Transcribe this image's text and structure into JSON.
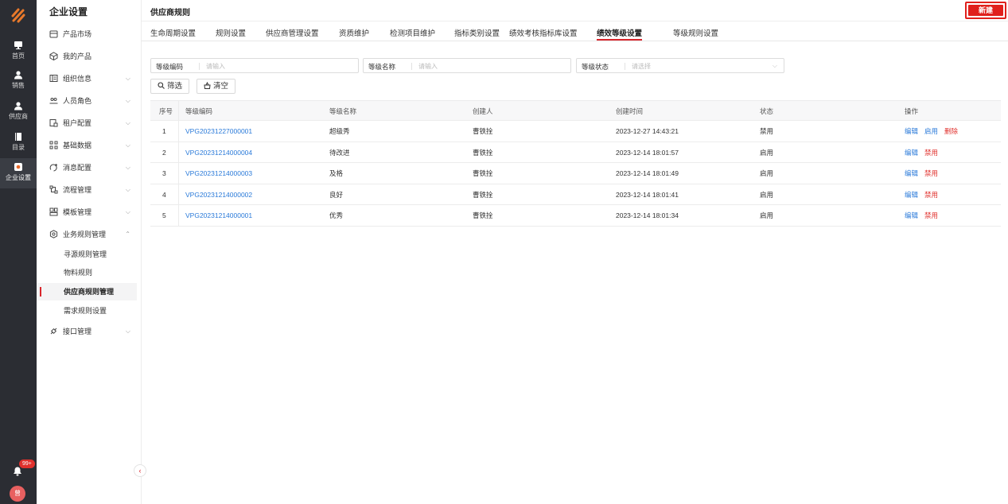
{
  "rail": {
    "items": [
      {
        "label": "首页",
        "icon": "monitor-icon"
      },
      {
        "label": "销售",
        "icon": "user-icon"
      },
      {
        "label": "供应商",
        "icon": "user-icon"
      },
      {
        "label": "目录",
        "icon": "book-icon"
      },
      {
        "label": "企业设置",
        "icon": "gear-icon"
      }
    ],
    "badge": "99+",
    "avatar": "曾"
  },
  "sidebar": {
    "title": "企业设置",
    "items": [
      {
        "label": "产品市场",
        "icon": "store-icon",
        "expandable": false
      },
      {
        "label": "我的产品",
        "icon": "box-icon",
        "expandable": false
      },
      {
        "label": "组织信息",
        "icon": "building-icon",
        "expandable": true
      },
      {
        "label": "人员角色",
        "icon": "people-icon",
        "expandable": true
      },
      {
        "label": "租户配置",
        "icon": "tenant-icon",
        "expandable": true
      },
      {
        "label": "基础数据",
        "icon": "grid-icon",
        "expandable": true
      },
      {
        "label": "消息配置",
        "icon": "message-icon",
        "expandable": true
      },
      {
        "label": "流程管理",
        "icon": "flow-icon",
        "expandable": true
      },
      {
        "label": "模板管理",
        "icon": "template-icon",
        "expandable": true
      },
      {
        "label": "业务规则管理",
        "icon": "settings-icon",
        "expandable": true
      }
    ],
    "sub_items": [
      "寻源规则管理",
      "物料规则",
      "供应商规则管理",
      "需求规则设置"
    ],
    "active_sub": "供应商规则管理",
    "last_item": {
      "label": "接口管理",
      "icon": "plug-icon"
    }
  },
  "header": {
    "title": "供应商规则",
    "new_button": "新建"
  },
  "tabs": [
    "生命周期设置",
    "规则设置",
    "供应商管理设置",
    "资质维护",
    "检测项目维护",
    "指标类别设置",
    "绩效考核指标库设置",
    "绩效等级设置",
    "等级规则设置"
  ],
  "active_tab": "绩效等级设置",
  "filters": {
    "code": {
      "label": "等级编码",
      "placeholder": "请输入"
    },
    "name": {
      "label": "等级名称",
      "placeholder": "请输入"
    },
    "status": {
      "label": "等级状态",
      "placeholder": "请选择"
    }
  },
  "buttons": {
    "filter": "筛选",
    "clear": "清空"
  },
  "table": {
    "headers": [
      "序号",
      "等级编码",
      "等级名称",
      "创建人",
      "创建时间",
      "状态",
      "操作"
    ],
    "rows": [
      {
        "index": "1",
        "code": "VPG20231227000001",
        "name": "超级秀",
        "creator": "曹铁拴",
        "created": "2023-12-27 14:43:21",
        "status": "禁用",
        "ops": [
          "编辑",
          "启用",
          "删除"
        ]
      },
      {
        "index": "2",
        "code": "VPG20231214000004",
        "name": "待改进",
        "creator": "曹铁拴",
        "created": "2023-12-14 18:01:57",
        "status": "启用",
        "ops": [
          "编辑",
          "禁用"
        ]
      },
      {
        "index": "3",
        "code": "VPG20231214000003",
        "name": "及格",
        "creator": "曹铁拴",
        "created": "2023-12-14 18:01:49",
        "status": "启用",
        "ops": [
          "编辑",
          "禁用"
        ]
      },
      {
        "index": "4",
        "code": "VPG20231214000002",
        "name": "良好",
        "creator": "曹铁拴",
        "created": "2023-12-14 18:01:41",
        "status": "启用",
        "ops": [
          "编辑",
          "禁用"
        ]
      },
      {
        "index": "5",
        "code": "VPG20231214000001",
        "name": "优秀",
        "creator": "曹铁拴",
        "created": "2023-12-14 18:01:34",
        "status": "启用",
        "ops": [
          "编辑",
          "禁用"
        ]
      }
    ]
  },
  "colors": {
    "accent": "#d9262c",
    "link": "#2a7ad9",
    "danger": "#e0302c",
    "rail": "#2b2d33"
  }
}
